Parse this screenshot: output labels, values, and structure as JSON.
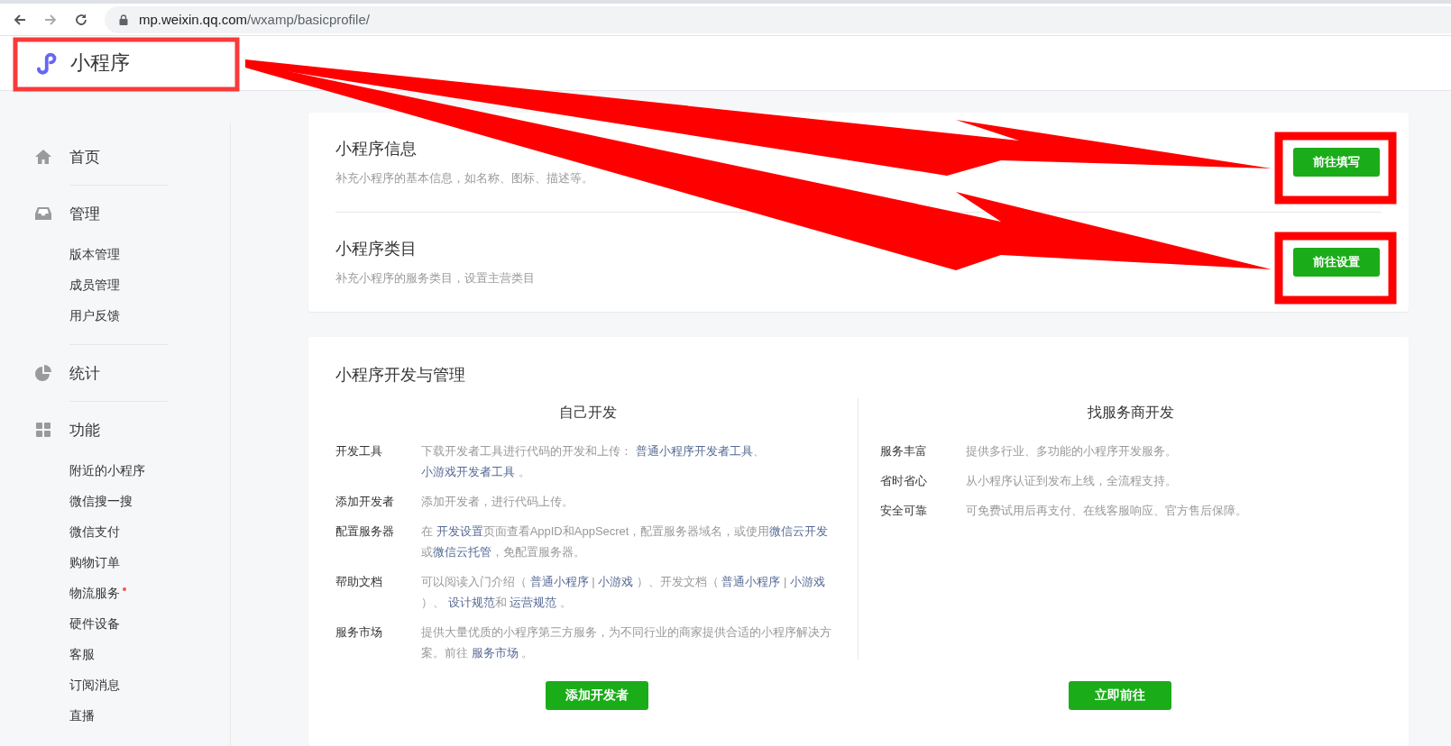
{
  "browser": {
    "url_host": "mp.weixin.qq.com",
    "url_path": "/wxamp/basicprofile/"
  },
  "header": {
    "title": "小程序"
  },
  "sidebar": [
    {
      "label": "首页"
    },
    {
      "label": "管理",
      "children": [
        {
          "label": "版本管理",
          "dot": false
        },
        {
          "label": "成员管理",
          "dot": false
        },
        {
          "label": "用户反馈",
          "dot": false
        }
      ]
    },
    {
      "label": "统计"
    },
    {
      "label": "功能",
      "children": [
        {
          "label": "附近的小程序",
          "dot": false
        },
        {
          "label": "微信搜一搜",
          "dot": false
        },
        {
          "label": "微信支付",
          "dot": false
        },
        {
          "label": "购物订单",
          "dot": false
        },
        {
          "label": "物流服务",
          "dot": true
        },
        {
          "label": "硬件设备",
          "dot": false
        },
        {
          "label": "客服",
          "dot": false
        },
        {
          "label": "订阅消息",
          "dot": false
        },
        {
          "label": "直播",
          "dot": false
        }
      ]
    }
  ],
  "setup": [
    {
      "title": "小程序信息",
      "desc": "补充小程序的基本信息，如名称、图标、描述等。",
      "button": "前往填写"
    },
    {
      "title": "小程序类目",
      "desc": "补充小程序的服务类目，设置主营类目",
      "button": "前往设置"
    }
  ],
  "dev": {
    "title": "小程序开发与管理",
    "columns": [
      {
        "heading": "自己开发",
        "button": "添加开发者",
        "rows": [
          {
            "label": "开发工具",
            "parts": [
              {
                "text": "下载开发者工具进行代码的开发和上传： ",
                "link": false
              },
              {
                "text": "普通小程序开发者工具",
                "link": true
              },
              {
                "text": "、 ",
                "link": false
              },
              {
                "text": "小游戏开发者工具",
                "link": true
              },
              {
                "text": " 。",
                "link": false
              }
            ]
          },
          {
            "label": "添加开发者",
            "parts": [
              {
                "text": "添加开发者，进行代码上传。",
                "link": false
              }
            ]
          },
          {
            "label": "配置服务器",
            "parts": [
              {
                "text": "在 ",
                "link": false
              },
              {
                "text": "开发设置",
                "link": true
              },
              {
                "text": "页面查看AppID和AppSecret，配置服务器域名，或使用",
                "link": false
              },
              {
                "text": "微信云开发",
                "link": true
              },
              {
                "text": "或",
                "link": false
              },
              {
                "text": "微信云托管",
                "link": true
              },
              {
                "text": "，免配置服务器。",
                "link": false
              }
            ]
          },
          {
            "label": "帮助文档",
            "parts": [
              {
                "text": "可以阅读入门介绍（ ",
                "link": false
              },
              {
                "text": "普通小程序",
                "link": true
              },
              {
                "text": " | ",
                "link": false
              },
              {
                "text": "小游戏",
                "link": true
              },
              {
                "text": " ）、开发文档（ ",
                "link": false
              },
              {
                "text": "普通小程序",
                "link": true
              },
              {
                "text": " | ",
                "link": false
              },
              {
                "text": "小游戏",
                "link": true
              },
              {
                "text": " ）、 ",
                "link": false
              },
              {
                "text": "设计规范",
                "link": true
              },
              {
                "text": "和 ",
                "link": false
              },
              {
                "text": "运营规范",
                "link": true
              },
              {
                "text": " 。",
                "link": false
              }
            ]
          },
          {
            "label": "服务市场",
            "parts": [
              {
                "text": "提供大量优质的小程序第三方服务，为不同行业的商家提供合适的小程序解决方案。前往 ",
                "link": false
              },
              {
                "text": "服务市场",
                "link": true
              },
              {
                "text": " 。",
                "link": false
              }
            ]
          }
        ]
      },
      {
        "heading": "找服务商开发",
        "button": "立即前往",
        "rows": [
          {
            "label": "服务丰富",
            "parts": [
              {
                "text": "提供多行业、多功能的小程序开发服务。",
                "link": false
              }
            ]
          },
          {
            "label": "省时省心",
            "parts": [
              {
                "text": "从小程序认证到发布上线，全流程支持。",
                "link": false
              }
            ]
          },
          {
            "label": "安全可靠",
            "parts": [
              {
                "text": "可免费试用后再支付、在线客服响应、官方售后保障。",
                "link": false
              }
            ]
          }
        ]
      }
    ]
  }
}
